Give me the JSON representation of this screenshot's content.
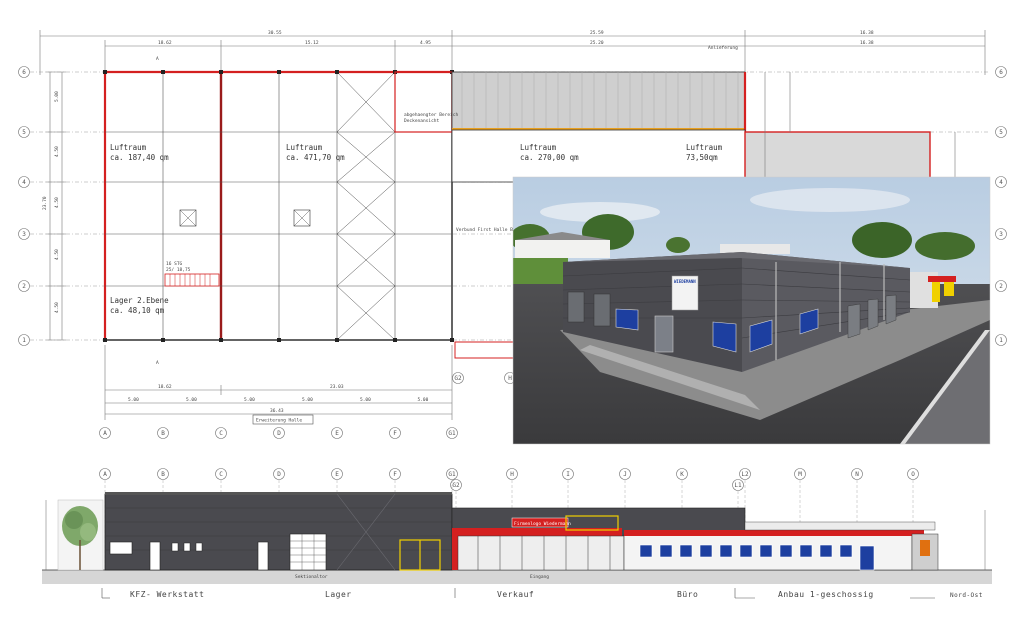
{
  "plan": {
    "dims_top": [
      "30.55",
      "25.59",
      "16.38"
    ],
    "dims_second": [
      "18.62",
      "15.12",
      "4.95",
      "25.20",
      "16.38"
    ],
    "dims_bottom": [
      "18.62",
      "23.03"
    ],
    "dims_bays": [
      "5.00",
      "5.00",
      "5.00",
      "5.00",
      "5.00",
      "5.00",
      "5.00"
    ],
    "dims_total": "36.43",
    "dim_anlieferung": "Anlieferung",
    "left_dims": [
      "5.00",
      "4.50",
      "4.50",
      "4.50",
      "4.50",
      "5.00"
    ],
    "left_total": "23.70",
    "grid_rows": [
      "6",
      "5",
      "4",
      "3",
      "2",
      "1"
    ],
    "grid_rows_right": [
      "6",
      "5",
      "4",
      "3",
      "2",
      "1"
    ],
    "grid_cols": [
      "A",
      "B",
      "C",
      "D",
      "E",
      "F",
      "G1"
    ],
    "grid_cols_right": [
      "G2",
      "H"
    ],
    "section_mark_a": "A",
    "section_mark_b": "A",
    "rooms": [
      {
        "line1": "Luftraum",
        "line2": "ca. 187,40 qm"
      },
      {
        "line1": "Luftraum",
        "line2": "ca. 471,70 qm"
      },
      {
        "line1": "Luftraum",
        "line2": "ca. 270,00 qm"
      },
      {
        "line1": "Luftraum",
        "line2": "73,50qm"
      }
    ],
    "lager": {
      "line1": "Lager 2.Ebene",
      "line2": "ca. 48,10 qm"
    },
    "abgehaengt": {
      "line1": "abgehaengter Bereich",
      "line2": "Deckenansicht"
    },
    "stair": {
      "line1": "16 STG",
      "line2": "25/ 18,75"
    },
    "bottom_label": "Erweiterung Halle",
    "note_small": "Verbund First Halle Bestand"
  },
  "elevation": {
    "grid_cols": [
      "A",
      "B",
      "C",
      "D",
      "E",
      "F",
      "G1",
      "G2",
      "H",
      "I",
      "J",
      "K",
      "L1",
      "L2",
      "M",
      "N",
      "O"
    ],
    "zones": [
      "KFZ- Werkstatt",
      "Lager",
      "Verkauf",
      "Büro",
      "Anbau 1-geschossig",
      "Nord-Ost"
    ],
    "sign_text": "Firmenlogo Wiedermann",
    "sub_labels": [
      "Sektionaltor",
      "Eingang"
    ]
  },
  "photo": {
    "sign_text": "WIEDEMANN"
  },
  "colors": {
    "red": "#d42020",
    "wall_dark": "#4a4a4f",
    "blue": "#1d3fa0",
    "yellow": "#f0d000",
    "sky": "#b9cde2"
  }
}
